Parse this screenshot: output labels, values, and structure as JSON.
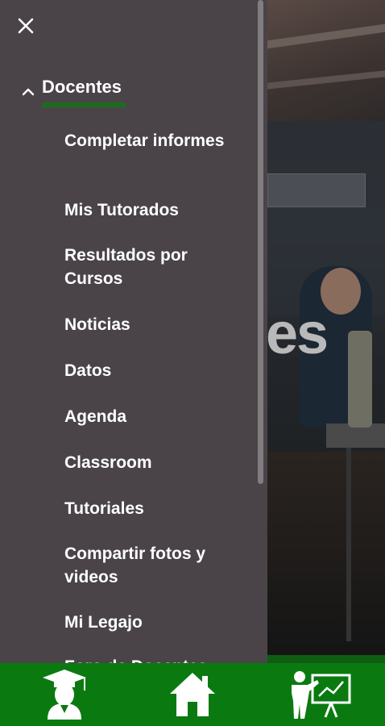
{
  "drawer": {
    "section_title": "Docentes",
    "items": [
      {
        "label": "Completar informes"
      },
      {
        "label": "Mis Tutorados"
      },
      {
        "label": "Resultados por Cursos"
      },
      {
        "label": "Noticias"
      },
      {
        "label": "Datos"
      },
      {
        "label": "Agenda"
      },
      {
        "label": "Classroom"
      },
      {
        "label": "Tutoriales"
      },
      {
        "label": "Compartir fotos y videos"
      },
      {
        "label": "Mi Legajo"
      },
      {
        "label": "Foro de Docentes"
      }
    ]
  },
  "hero": {
    "partial_text": "es"
  },
  "bottom_nav": [
    {
      "icon": "graduate-icon"
    },
    {
      "icon": "home-icon"
    },
    {
      "icon": "teacher-board-icon"
    }
  ],
  "colors": {
    "drawer_bg": "#4a4448",
    "accent_green": "#1b6d1d",
    "nav_green": "#0a7a10",
    "text": "#ffffff"
  }
}
